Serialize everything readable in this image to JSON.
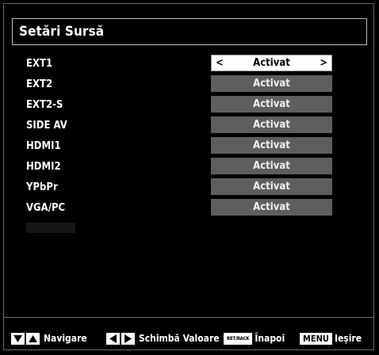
{
  "panel": {
    "title": "Setări Sursă"
  },
  "sources": [
    {
      "label": "EXT1",
      "value": "Activat",
      "selected": true
    },
    {
      "label": "EXT2",
      "value": "Activat",
      "selected": false
    },
    {
      "label": "EXT2-S",
      "value": "Activat",
      "selected": false
    },
    {
      "label": "SIDE AV",
      "value": "Activat",
      "selected": false
    },
    {
      "label": "HDMI1",
      "value": "Activat",
      "selected": false
    },
    {
      "label": "HDMI2",
      "value": "Activat",
      "selected": false
    },
    {
      "label": "YPbPr",
      "value": "Activat",
      "selected": false
    },
    {
      "label": "VGA/PC",
      "value": "Activat",
      "selected": false
    }
  ],
  "selector_arrows": {
    "left": "<",
    "right": ">"
  },
  "footer": {
    "navigate_label": "Navigare",
    "change_value_label": "Schimbă Valoare",
    "back_key": "RET/BACK",
    "back_label": "Înapoi",
    "menu_key": "MENU",
    "exit_label": "Ieşire"
  },
  "colors": {
    "background": "#000000",
    "value_bar": "#5e5e5e",
    "selected_value_bar": "#ffffff",
    "text": "#ffffff"
  }
}
